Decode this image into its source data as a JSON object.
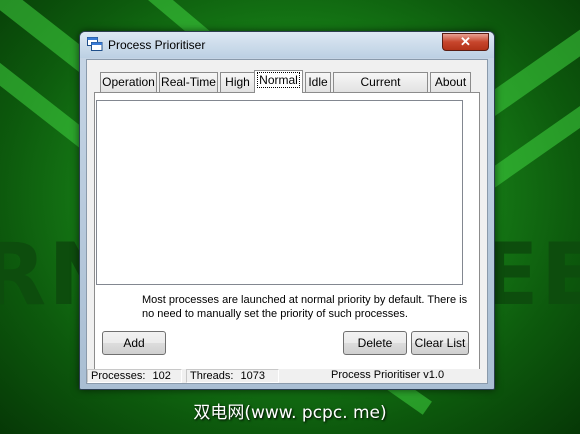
{
  "window": {
    "title": "Process Prioritiser",
    "close_glyph": "✕",
    "title_icon": "windows-stack-icon"
  },
  "tabs": [
    {
      "label": "Operation",
      "active": false
    },
    {
      "label": "Real-Time",
      "active": false
    },
    {
      "label": "High",
      "active": false
    },
    {
      "label": "Normal",
      "active": true
    },
    {
      "label": "Idle",
      "active": false
    },
    {
      "label": "Current Processes",
      "active": false
    },
    {
      "label": "About",
      "active": false
    }
  ],
  "normal_tab": {
    "process_list": [],
    "description": "Most processes are launched at normal priority by default. There is no need to manually set the priority of such processes.",
    "add_label": "Add",
    "delete_label": "Delete",
    "clear_label": "Clear List"
  },
  "status": {
    "processes_label": "Processes:",
    "processes_value": "102",
    "threads_label": "Threads:",
    "threads_value": "1073",
    "version": "Process Prioritiser v1.0"
  },
  "desktop": {
    "watermark": "双电网(www. pcpc. me)"
  },
  "colors": {
    "wallpaper": "#1a8a1a",
    "close_button": "#c7452c"
  }
}
